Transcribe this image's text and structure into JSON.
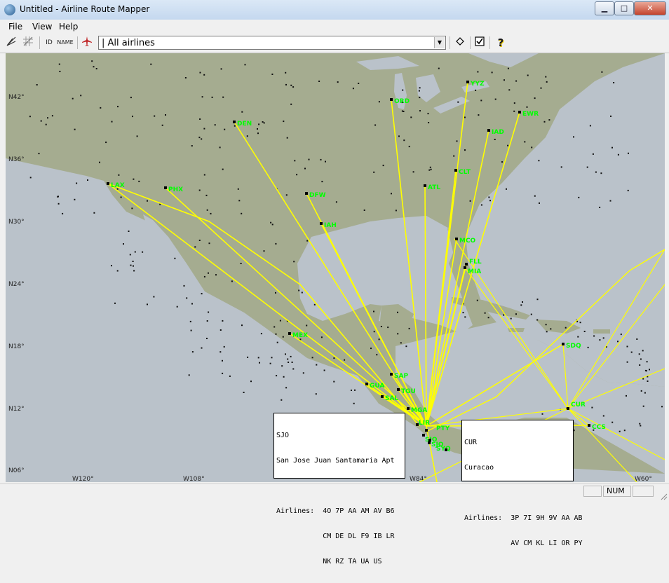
{
  "window": {
    "title": "Untitled - Airline Route Mapper",
    "controls": {
      "minimize": "▁",
      "maximize": "□",
      "close": "✕"
    }
  },
  "menu": {
    "items": [
      "File",
      "View",
      "Help"
    ]
  },
  "toolbar": {
    "id_label": "ID",
    "name_label": "NAME",
    "airline_filter": "| All airlines",
    "help_glyph": "?"
  },
  "map": {
    "background_color": "#a5ac90",
    "water_color": "#bac2ca",
    "route_color": "#ffff00",
    "label_color": "#00ff00",
    "lat_labels": [
      "N42°",
      "N36°",
      "N30°",
      "N24°",
      "N18°",
      "N12°",
      "N06°"
    ],
    "lon_labels": [
      "W120°",
      "W108°",
      "W84°",
      "W60°"
    ],
    "airport_labels": [
      {
        "code": "ORD"
      },
      {
        "code": "YYZ"
      },
      {
        "code": "EWR"
      },
      {
        "code": "IAD"
      },
      {
        "code": "DEN"
      },
      {
        "code": "CLT"
      },
      {
        "code": "LAX"
      },
      {
        "code": "PHX"
      },
      {
        "code": "DFW"
      },
      {
        "code": "ATL"
      },
      {
        "code": "IAH"
      },
      {
        "code": "MCO"
      },
      {
        "code": "FLL"
      },
      {
        "code": "MIA"
      },
      {
        "code": "MEX"
      },
      {
        "code": "SDQ"
      },
      {
        "code": "SAP"
      },
      {
        "code": "GUA"
      },
      {
        "code": "TGU"
      },
      {
        "code": "SAL"
      },
      {
        "code": "MGA"
      },
      {
        "code": "LIR"
      },
      {
        "code": "PTY"
      },
      {
        "code": "CCS"
      },
      {
        "code": "SJO"
      },
      {
        "code": "SJO"
      },
      {
        "code": "SYQ"
      },
      {
        "code": "DAV"
      },
      {
        "code": "CUR"
      }
    ]
  },
  "info_sjo": {
    "lines": [
      "SJO",
      "San Jose Juan Santamaria Apt",
      "",
      "Airlines:  4O 7P AA AM AV B6",
      "           CM DE DL F9 IB LR",
      "           NK RZ TA UA US"
    ]
  },
  "info_cur": {
    "lines": [
      "CUR",
      "Curacao",
      "",
      "Airlines:  3P 7I 9H 9V AA AB",
      "           AV CM KL LI OR PY"
    ]
  },
  "status": {
    "num": "NUM"
  }
}
